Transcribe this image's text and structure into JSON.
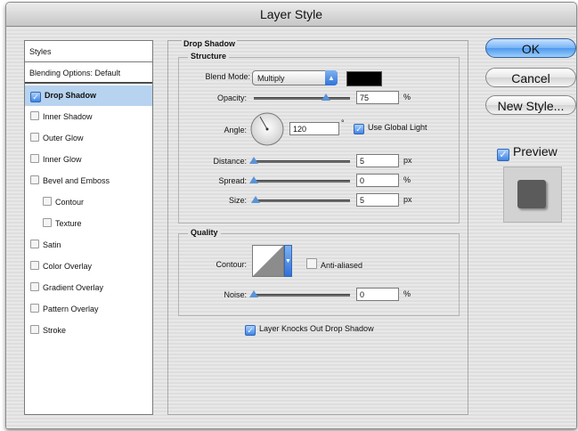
{
  "window": {
    "title": "Layer Style"
  },
  "sidebar": {
    "header": "Styles",
    "blending_options": "Blending Options: Default",
    "items": [
      {
        "label": "Drop Shadow",
        "checked": true,
        "selected": true,
        "indent": false
      },
      {
        "label": "Inner Shadow",
        "checked": false,
        "selected": false,
        "indent": false
      },
      {
        "label": "Outer Glow",
        "checked": false,
        "selected": false,
        "indent": false
      },
      {
        "label": "Inner Glow",
        "checked": false,
        "selected": false,
        "indent": false
      },
      {
        "label": "Bevel and Emboss",
        "checked": false,
        "selected": false,
        "indent": false
      },
      {
        "label": "Contour",
        "checked": false,
        "selected": false,
        "indent": true
      },
      {
        "label": "Texture",
        "checked": false,
        "selected": false,
        "indent": true
      },
      {
        "label": "Satin",
        "checked": false,
        "selected": false,
        "indent": false
      },
      {
        "label": "Color Overlay",
        "checked": false,
        "selected": false,
        "indent": false
      },
      {
        "label": "Gradient Overlay",
        "checked": false,
        "selected": false,
        "indent": false
      },
      {
        "label": "Pattern Overlay",
        "checked": false,
        "selected": false,
        "indent": false
      },
      {
        "label": "Stroke",
        "checked": false,
        "selected": false,
        "indent": false
      }
    ]
  },
  "drop_shadow": {
    "title": "Drop Shadow",
    "structure": {
      "title": "Structure",
      "blend_mode_label": "Blend Mode:",
      "blend_mode_value": "Multiply",
      "shadow_color": "#000000",
      "opacity_label": "Opacity:",
      "opacity_value": "75",
      "opacity_unit": "%",
      "opacity_slider": 0.75,
      "angle_label": "Angle:",
      "angle_value": "120",
      "angle_unit": "°",
      "angle_degrees": 120,
      "global_light_label": "Use Global Light",
      "global_light_checked": true,
      "distance_label": "Distance:",
      "distance_value": "5",
      "distance_unit": "px",
      "distance_slider": 0.0,
      "spread_label": "Spread:",
      "spread_value": "0",
      "spread_unit": "%",
      "spread_slider": 0.0,
      "size_label": "Size:",
      "size_value": "5",
      "size_unit": "px",
      "size_slider": 0.02
    },
    "quality": {
      "title": "Quality",
      "contour_label": "Contour:",
      "anti_aliased_label": "Anti-aliased",
      "anti_aliased_checked": false,
      "noise_label": "Noise:",
      "noise_value": "0",
      "noise_unit": "%",
      "noise_slider": 0.0
    },
    "knockout_label": "Layer Knocks Out Drop Shadow",
    "knockout_checked": true
  },
  "buttons": {
    "ok": "OK",
    "cancel": "Cancel",
    "new_style": "New Style..."
  },
  "preview": {
    "label": "Preview",
    "checked": true
  },
  "colors": {
    "accent": "#5a93d8",
    "selection": "#b7d3ef"
  },
  "icons": {
    "checkbox_checked": "checkmark-icon",
    "dropdown": "dropdown-arrow-icon",
    "slider": "triangle-thumb-icon"
  }
}
